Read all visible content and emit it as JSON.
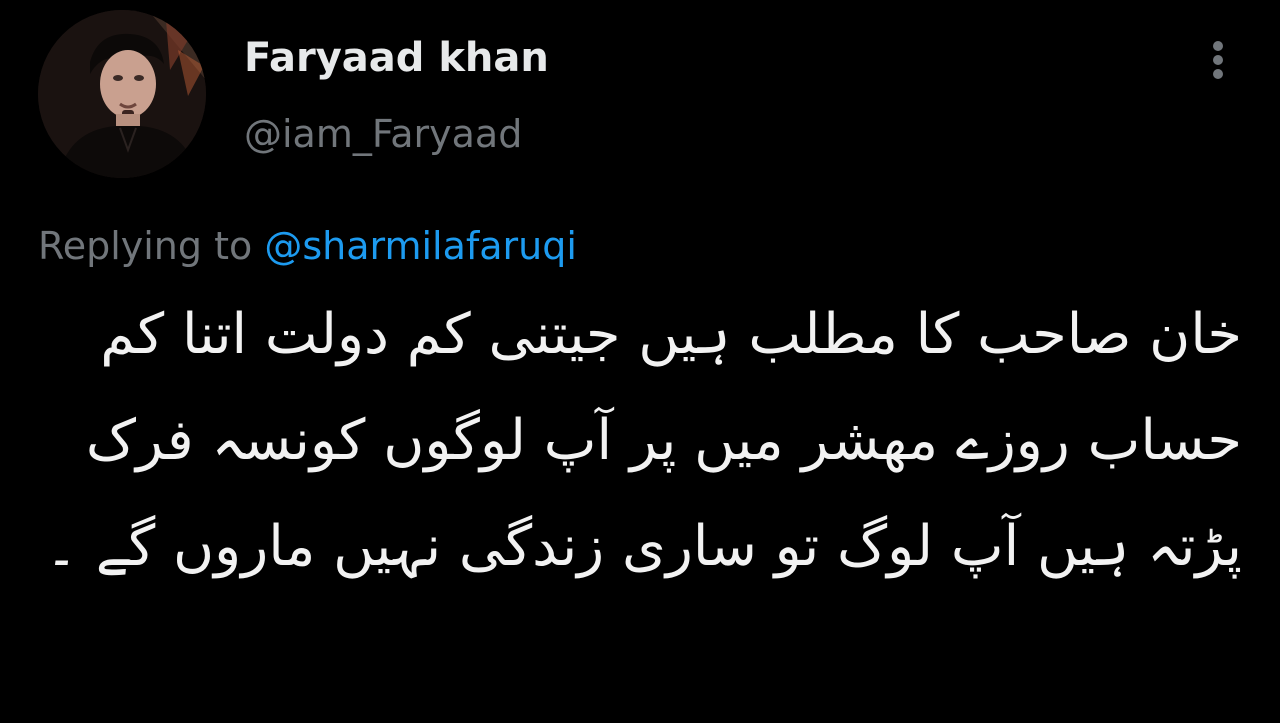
{
  "tweet": {
    "author": {
      "display_name": "Faryaad khan",
      "handle": "@iam_Faryaad"
    },
    "reply": {
      "prefix": "Replying to",
      "mention": "@sharmilafaruqi"
    },
    "text": "خان صاحب کا مطلب ہیں جیتنی کم دولت اتنا کم حساب روزے مھشر میں پر آپ لوگوں کونسہ فرک پڑتہ ہیں آپ لوگ تو ساری زندگی نہیں ماروں گے ۔"
  },
  "icons": {
    "more": "more-vertical-icon",
    "avatar": "profile-photo"
  },
  "colors": {
    "background": "#000000",
    "primary_text": "#e7e9ea",
    "secondary_text": "#71767b",
    "link": "#1d9bf0"
  }
}
